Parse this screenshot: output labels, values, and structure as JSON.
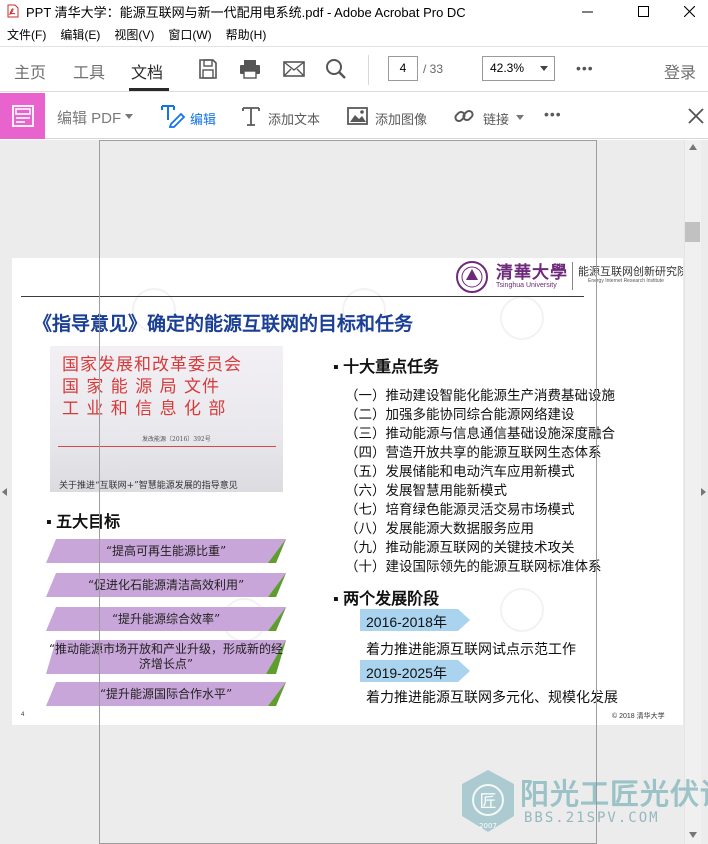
{
  "window": {
    "title": "PPT 清华大学：能源互联网与新一代配用电系统.pdf - Adobe Acrobat Pro DC",
    "minimize_glyph": "—",
    "maximize_glyph": "☐",
    "close_glyph": "✕"
  },
  "menu": [
    "文件(F)",
    "编辑(E)",
    "视图(V)",
    "窗口(W)",
    "帮助(H)"
  ],
  "tabs": {
    "home": "主页",
    "tools": "工具",
    "document": "文档"
  },
  "toolbar": {
    "page_current": "4",
    "page_total": "/ 33",
    "zoom": "42.3%",
    "more": "•••",
    "login": "登录"
  },
  "edit_toolbar": {
    "edit_pdf": "编辑 PDF",
    "edit": "编辑",
    "add_text": "添加文本",
    "add_image": "添加图像",
    "link": "链接",
    "more": "•••"
  },
  "slide": {
    "title": "《指导意见》确定的能源互联网的目标和任务",
    "university_cn": "清華大學",
    "university_en": "Tsinghua University",
    "institute_cn": "能源互联网创新研究院",
    "institute_en": "Energy Internet Research Institute",
    "doc_image": {
      "line1": "国家发展和改革委员会",
      "line2": "国 家 能 源 局 文件",
      "line3": "工 业 和 信 息 化 部",
      "number": "发改能源〔2016〕392号",
      "caption": "关于推进“互联网+”智慧能源发展的指导意见"
    },
    "goals_heading": "▪ 五大目标",
    "goals": [
      "“提高可再生能源比重”",
      "“促进化石能源清洁高效利用”",
      "“提升能源综合效率”",
      "“推动能源市场开放和产业升级，形成新的经济增长点”",
      "“提升能源国际合作水平”"
    ],
    "tasks_heading": "▪ 十大重点任务",
    "tasks": [
      "（一）推动建设智能化能源生产消费基础设施",
      "（二）加强多能协同综合能源网络建设",
      "（三）推动能源与信息通信基础设施深度融合",
      "（四）营造开放共享的能源互联网生态体系",
      "（五）发展储能和电动汽车应用新模式",
      "（六）发展智慧用能新模式",
      "（七）培育绿色能源灵活交易市场模式",
      "（八）发展能源大数据服务应用",
      "（九）推动能源互联网的关键技术攻关",
      "（十）建设国际领先的能源互联网标准体系"
    ],
    "stages_heading": "▪ 两个发展阶段",
    "stages": [
      {
        "years": "2016-2018年",
        "desc": "着力推进能源互联网试点示范工作"
      },
      {
        "years": "2019-2025年",
        "desc": "着力推进能源互联网多元化、规模化发展"
      }
    ],
    "page_number": "4",
    "copyright": "© 2018 清华大学"
  },
  "forum_watermark": {
    "name": "阳光工匠光伏论坛",
    "url": "BBS.21SPV.COM",
    "badge_year": "2007",
    "badge_char": "匠"
  },
  "colors": {
    "title_blue": "#1a3f94",
    "edit_pink": "#e863cd",
    "edit_blue": "#1473e6",
    "goal_band": "#c9a6d9",
    "goal_accent": "#5e9e2c",
    "stage_band": "#a9d3ee",
    "doc_red": "#d63b3b"
  }
}
